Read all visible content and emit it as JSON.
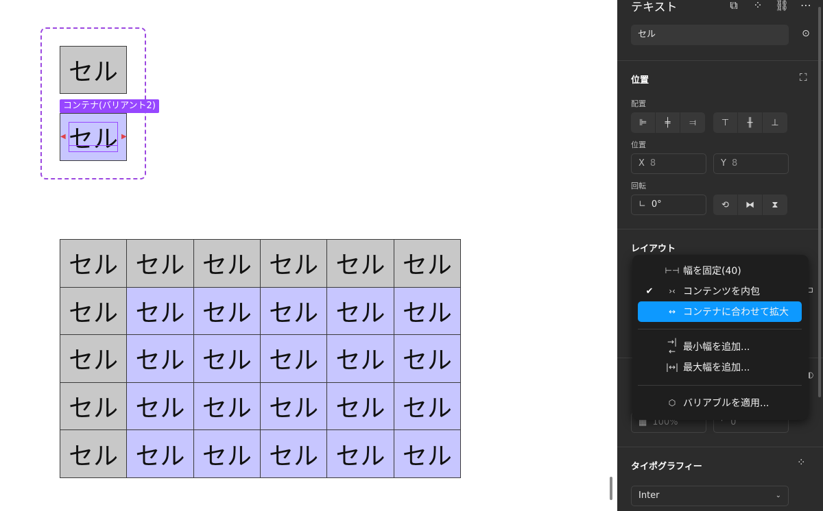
{
  "canvas": {
    "top_cell": "セル",
    "variant_tag": "コンテナ(バリアント2)",
    "selected_cell": "セル",
    "grid": {
      "rows": [
        [
          {
            "t": "セル",
            "c": "g"
          },
          {
            "t": "セル",
            "c": "g"
          },
          {
            "t": "セル",
            "c": "g"
          },
          {
            "t": "セル",
            "c": "g"
          },
          {
            "t": "セル",
            "c": "g"
          },
          {
            "t": "セル",
            "c": "g"
          }
        ],
        [
          {
            "t": "セル",
            "c": "g"
          },
          {
            "t": "セル",
            "c": "p"
          },
          {
            "t": "セル",
            "c": "p"
          },
          {
            "t": "セル",
            "c": "p"
          },
          {
            "t": "セル",
            "c": "p"
          },
          {
            "t": "セル",
            "c": "p"
          }
        ],
        [
          {
            "t": "セル",
            "c": "g"
          },
          {
            "t": "セル",
            "c": "p"
          },
          {
            "t": "セル",
            "c": "p"
          },
          {
            "t": "セル",
            "c": "p"
          },
          {
            "t": "セル",
            "c": "p"
          },
          {
            "t": "セル",
            "c": "p"
          }
        ],
        [
          {
            "t": "セル",
            "c": "g"
          },
          {
            "t": "セル",
            "c": "p"
          },
          {
            "t": "セル",
            "c": "p"
          },
          {
            "t": "セル",
            "c": "p"
          },
          {
            "t": "セル",
            "c": "p"
          },
          {
            "t": "セル",
            "c": "p"
          }
        ],
        [
          {
            "t": "セル",
            "c": "g"
          },
          {
            "t": "セル",
            "c": "p"
          },
          {
            "t": "セル",
            "c": "p"
          },
          {
            "t": "セル",
            "c": "p"
          },
          {
            "t": "セル",
            "c": "p"
          },
          {
            "t": "セル",
            "c": "p"
          }
        ]
      ]
    }
  },
  "panel": {
    "title": "テキスト",
    "layer_name": "セル",
    "position_section": {
      "title": "位置",
      "align_label": "配置",
      "position_label": "位置",
      "x_label": "X",
      "x_value": "8",
      "y_label": "Y",
      "y_value": "8",
      "rotation_label": "回転",
      "rotation_value": "0°"
    },
    "layout_section": {
      "title": "レイアウト",
      "opacity_value": "100%",
      "radius_value": "0"
    },
    "typography_section": {
      "title": "タイポグラフィー",
      "font": "Inter"
    }
  },
  "menu": {
    "items": [
      {
        "label": "幅を固定(40)",
        "icon": "⊢⊣",
        "checked": false,
        "active": false
      },
      {
        "label": "コンテンツを内包",
        "icon": "›‹",
        "checked": true,
        "active": false
      },
      {
        "label": "コンテナに合わせて拡大",
        "icon": "↔",
        "checked": false,
        "active": true
      },
      {
        "label": "最小幅を追加...",
        "icon": "→|←",
        "checked": false,
        "active": false
      },
      {
        "label": "最大幅を追加...",
        "icon": "|↔|",
        "checked": false,
        "active": false
      },
      {
        "label": "バリアブルを適用...",
        "icon": "⬡",
        "checked": false,
        "active": false
      }
    ]
  },
  "colors": {
    "accent": "#0d99ff",
    "variant_purple": "#9747ff",
    "cell_gray": "#c8c8c8",
    "cell_purple": "#c7c6ff",
    "panel_bg": "#2c2c2c"
  }
}
